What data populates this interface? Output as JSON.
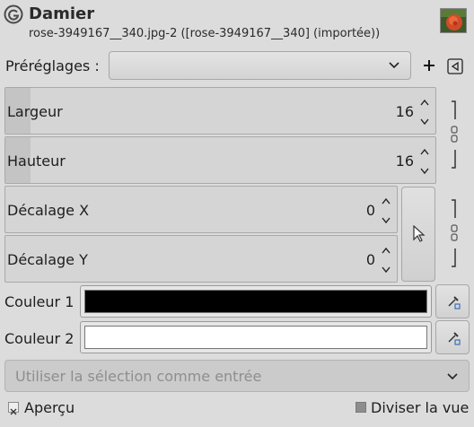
{
  "header": {
    "title": "Damier",
    "subtitle": "rose-3949167__340.jpg-2 ([rose-3949167__340] (importée))",
    "logo_icon": "gimp-logo-icon",
    "thumbnail_icon": "rose-thumbnail"
  },
  "presets": {
    "label": "Préréglages :",
    "value": "",
    "add_icon": "plus-icon",
    "menu_icon": "menu-triangle-icon"
  },
  "fields": {
    "width": {
      "label": "Largeur",
      "value": "16"
    },
    "height": {
      "label": "Hauteur",
      "value": "16"
    },
    "offset_x": {
      "label": "Décalage X",
      "value": "0"
    },
    "offset_y": {
      "label": "Décalage Y",
      "value": "0"
    }
  },
  "colors": {
    "color1": {
      "label": "Couleur 1",
      "value": "#000000"
    },
    "color2": {
      "label": "Couleur 2",
      "value": "#ffffff"
    }
  },
  "selection": {
    "label": "Utiliser la sélection comme entrée"
  },
  "footer": {
    "preview_label": "Aperçu",
    "preview_checked": true,
    "split_label": "Diviser la vue",
    "split_checked": false
  }
}
